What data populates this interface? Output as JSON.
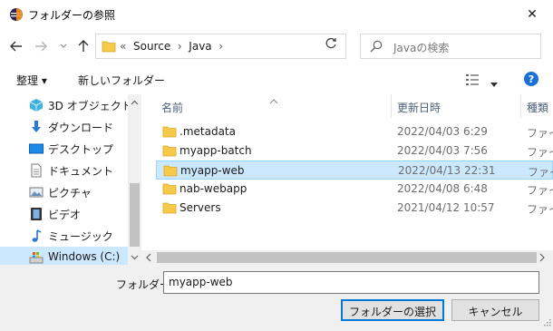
{
  "window": {
    "title": "フォルダーの参照",
    "close_glyph": "✕"
  },
  "navigation": {
    "address_chevron": "«",
    "breadcrumb": [
      "Source",
      "Java"
    ],
    "search_placeholder": "Javaの検索"
  },
  "command_bar": {
    "organize_label": "整理 ▾",
    "new_folder_label": "新しいフォルダー",
    "help_glyph": "?"
  },
  "sidebar": {
    "items": [
      {
        "label": "3D オブジェクト",
        "icon": "3d-objects-icon"
      },
      {
        "label": "ダウンロード",
        "icon": "download-icon"
      },
      {
        "label": "デスクトップ",
        "icon": "desktop-icon"
      },
      {
        "label": "ドキュメント",
        "icon": "documents-icon"
      },
      {
        "label": "ピクチャ",
        "icon": "pictures-icon"
      },
      {
        "label": "ビデオ",
        "icon": "videos-icon"
      },
      {
        "label": "ミュージック",
        "icon": "music-icon"
      },
      {
        "label": "Windows (C:)",
        "icon": "drive-icon",
        "selected": true
      }
    ]
  },
  "file_list": {
    "columns": [
      "名前",
      "更新日時",
      "種類"
    ],
    "rows": [
      {
        "name": ".metadata",
        "modified": "2022/04/03 6:29",
        "type": "ファイル"
      },
      {
        "name": "myapp-batch",
        "modified": "2022/04/03 7:56",
        "type": "ファイル"
      },
      {
        "name": "myapp-web",
        "modified": "2022/04/13 22:31",
        "type": "ファイル",
        "selected": true
      },
      {
        "name": "nab-webapp",
        "modified": "2022/04/08 6:48",
        "type": "ファイル"
      },
      {
        "name": "Servers",
        "modified": "2021/04/12 10:57",
        "type": "ファイル"
      }
    ]
  },
  "footer": {
    "folder_label": "フォルダー:",
    "folder_value": "myapp-web",
    "select_button": "フォルダーの選択",
    "cancel_button": "キャンセル"
  },
  "colors": {
    "accent": "#0078d7",
    "selection": "#cce8ff",
    "folder": "#f7c948"
  }
}
